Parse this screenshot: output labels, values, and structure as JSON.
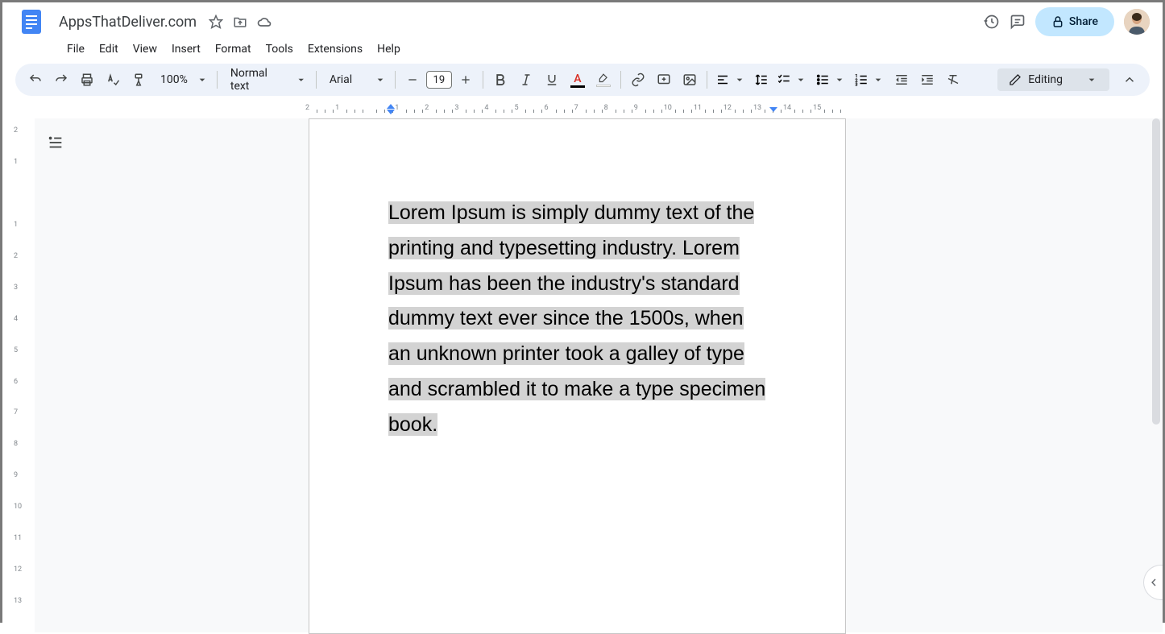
{
  "header": {
    "doc_title": "AppsThatDeliver.com",
    "share_label": "Share"
  },
  "menu": {
    "items": [
      "File",
      "Edit",
      "View",
      "Insert",
      "Format",
      "Tools",
      "Extensions",
      "Help"
    ]
  },
  "toolbar": {
    "zoom": "100%",
    "style": "Normal text",
    "font": "Arial",
    "font_size": "19",
    "mode": "Editing"
  },
  "ruler_h": [
    "2",
    "1",
    "",
    "1",
    "2",
    "3",
    "4",
    "5",
    "6",
    "7",
    "8",
    "9",
    "10",
    "11",
    "12",
    "13",
    "14",
    "15"
  ],
  "ruler_v": [
    "2",
    "1",
    "",
    "1",
    "2",
    "3",
    "4",
    "5",
    "6",
    "7",
    "8",
    "9",
    "10",
    "11",
    "12",
    "13"
  ],
  "document": {
    "selected_text": "Lorem Ipsum is simply dummy text of the printing and typesetting industry. Lorem Ipsum has been the industry's standard dummy text ever since the 1500s, when an unknown printer took a galley of type and scrambled it to make a type specimen book."
  }
}
